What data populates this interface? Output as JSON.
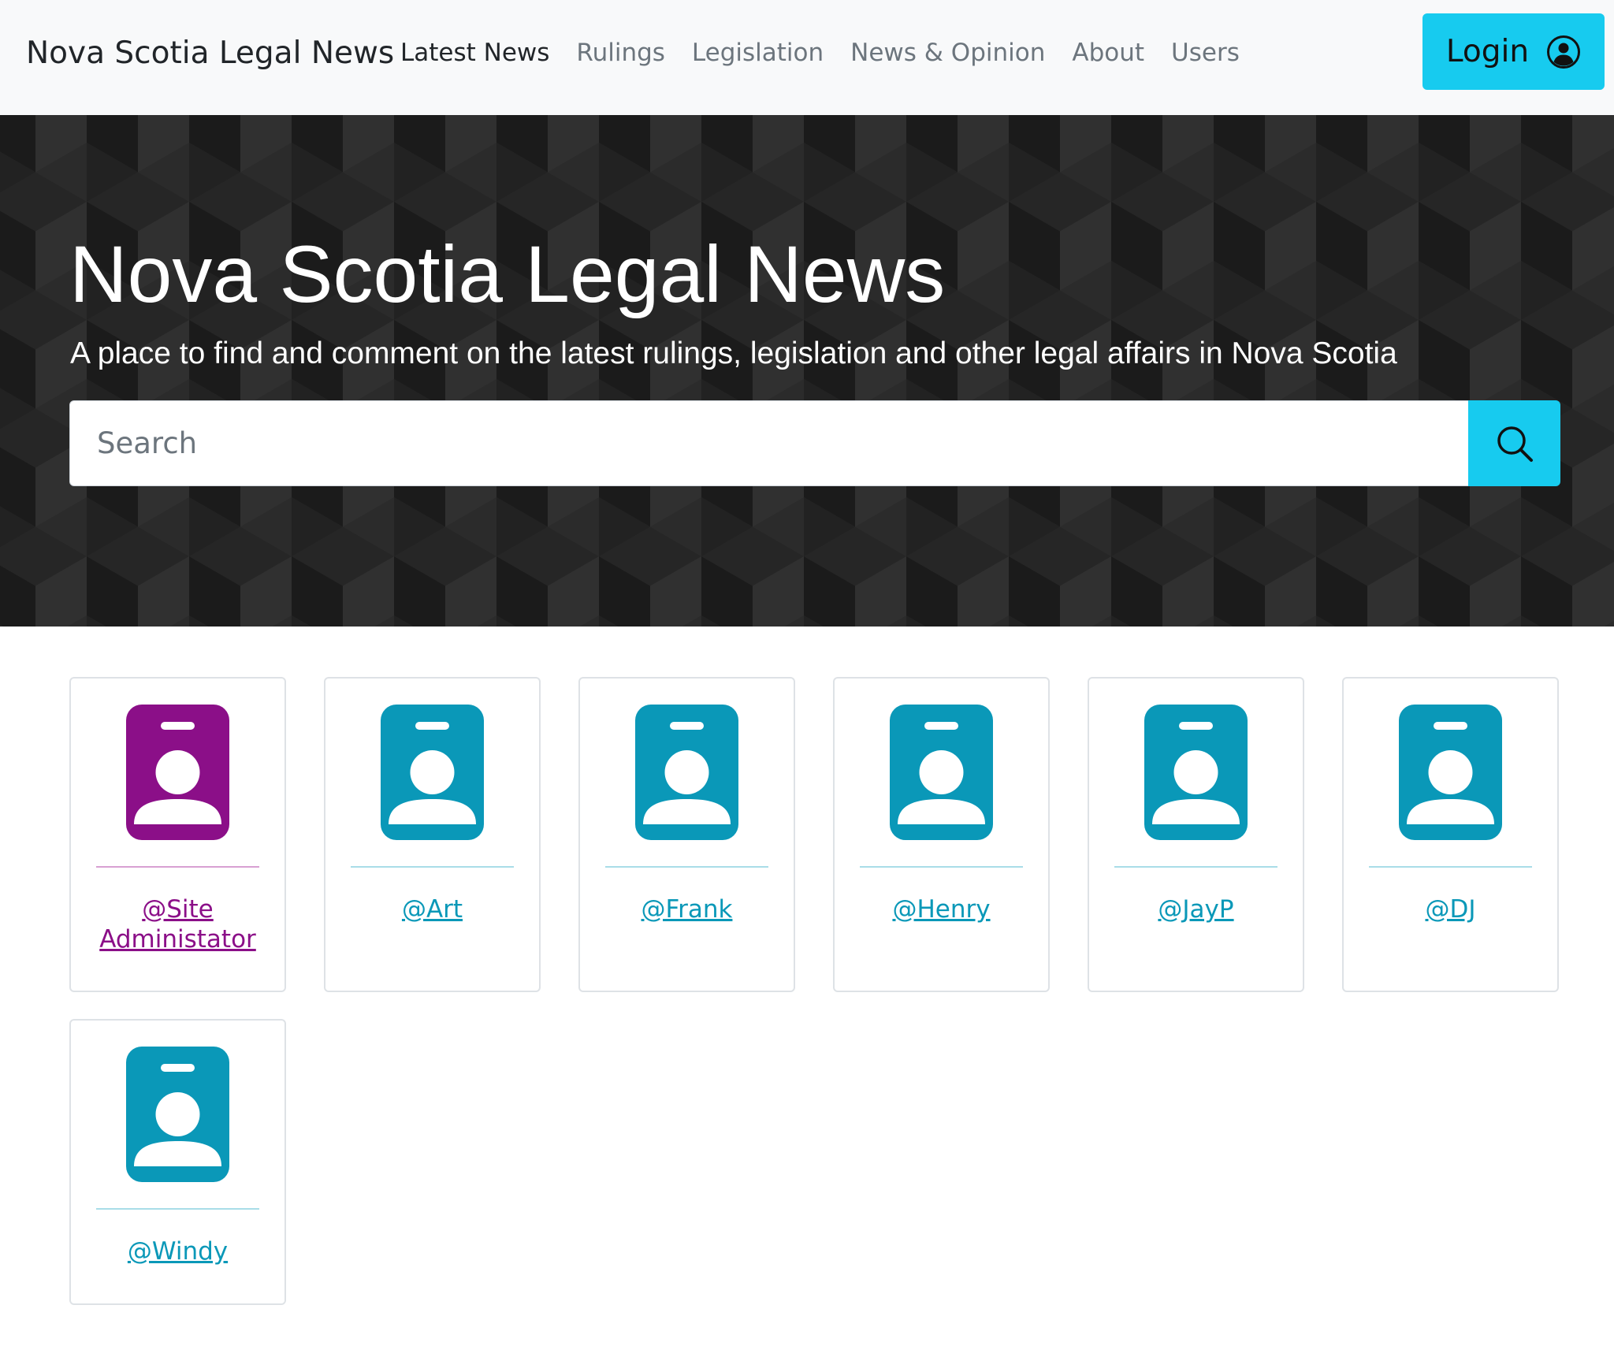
{
  "navbar": {
    "brand": "Nova Scotia Legal News",
    "links": [
      {
        "label": "Latest News",
        "active": true
      },
      {
        "label": "Rulings",
        "active": false
      },
      {
        "label": "Legislation",
        "active": false
      },
      {
        "label": "News & Opinion",
        "active": false
      },
      {
        "label": "About",
        "active": false
      },
      {
        "label": "Users",
        "active": false
      }
    ],
    "login_label": "Login",
    "login_icon": "user-circle-icon"
  },
  "hero": {
    "title": "Nova Scotia Legal News",
    "subtitle": "A place to find and comment on the latest rulings, legislation and other legal affairs in Nova Scotia",
    "search_placeholder": "Search",
    "search_value": "",
    "search_icon": "search-icon"
  },
  "users": [
    {
      "handle": "@Site Administator",
      "role": "admin",
      "icon": "person-badge-icon"
    },
    {
      "handle": "@Art",
      "role": "user",
      "icon": "person-badge-icon"
    },
    {
      "handle": "@Frank",
      "role": "user",
      "icon": "person-badge-icon"
    },
    {
      "handle": "@Henry",
      "role": "user",
      "icon": "person-badge-icon"
    },
    {
      "handle": "@JayP",
      "role": "user",
      "icon": "person-badge-icon"
    },
    {
      "handle": "@DJ",
      "role": "user",
      "icon": "person-badge-icon"
    },
    {
      "handle": "@Windy",
      "role": "user",
      "icon": "person-badge-icon"
    }
  ],
  "colors": {
    "accent": "#17cbef",
    "admin": "#8b0f88",
    "user": "#0a98b8",
    "navbar_bg": "#f8f9fa",
    "hero_bg": "#222222"
  }
}
